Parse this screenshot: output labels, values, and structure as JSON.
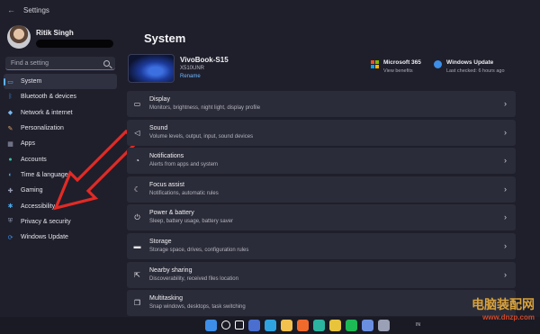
{
  "window": {
    "title": "Settings"
  },
  "profile": {
    "name": "Ritik Singh"
  },
  "search": {
    "placeholder": "Find a setting"
  },
  "nav": [
    {
      "label": "System",
      "icon": "monitor-icon",
      "active": true,
      "color": "#5fb2ff"
    },
    {
      "label": "Bluetooth & devices",
      "icon": "bluetooth-icon",
      "color": "#3a8fe3"
    },
    {
      "label": "Network & internet",
      "icon": "wifi-icon",
      "color": "#7ab8f0"
    },
    {
      "label": "Personalization",
      "icon": "brush-icon",
      "color": "#e0a060"
    },
    {
      "label": "Apps",
      "icon": "apps-icon",
      "color": "#9aa0b5"
    },
    {
      "label": "Accounts",
      "icon": "person-icon",
      "color": "#3ac0a0"
    },
    {
      "label": "Time & language",
      "icon": "globe-clock-icon",
      "color": "#4aa6e8"
    },
    {
      "label": "Gaming",
      "icon": "gamepad-icon",
      "color": "#9aa0b5"
    },
    {
      "label": "Accessibility",
      "icon": "accessibility-icon",
      "color": "#4aa6e8"
    },
    {
      "label": "Privacy & security",
      "icon": "shield-icon",
      "color": "#8e98b0"
    },
    {
      "label": "Windows Update",
      "icon": "update-icon",
      "color": "#3d8ee8"
    }
  ],
  "main": {
    "title": "System",
    "device": {
      "name": "VivoBook-S15",
      "model": "X510UNR",
      "rename": "Rename"
    },
    "quick": [
      {
        "title": "Microsoft 365",
        "sub": "View benefits",
        "icon": "microsoft-365-icon"
      },
      {
        "title": "Windows Update",
        "sub": "Last checked: 6 hours ago",
        "icon": "windows-update-icon"
      }
    ],
    "cards": [
      {
        "title": "Display",
        "sub": "Monitors, brightness, night light, display profile",
        "icon": "display-icon"
      },
      {
        "title": "Sound",
        "sub": "Volume levels, output, input, sound devices",
        "icon": "speaker-icon"
      },
      {
        "title": "Notifications",
        "sub": "Alerts from apps and system",
        "icon": "bell-icon"
      },
      {
        "title": "Focus assist",
        "sub": "Notifications, automatic rules",
        "icon": "moon-icon"
      },
      {
        "title": "Power & battery",
        "sub": "Sleep, battery usage, battery saver",
        "icon": "power-icon"
      },
      {
        "title": "Storage",
        "sub": "Storage space, drives, configuration rules",
        "icon": "storage-icon"
      },
      {
        "title": "Nearby sharing",
        "sub": "Discoverability, received files location",
        "icon": "share-icon"
      },
      {
        "title": "Multitasking",
        "sub": "Snap windows, desktops, task switching",
        "icon": "multitask-icon"
      }
    ]
  },
  "taskbar": {
    "icons": [
      "windows-start-icon",
      "search-icon",
      "task-view-icon",
      "widgets-icon",
      "telegram-icon",
      "file-explorer-icon",
      "brave-icon",
      "edge-icon",
      "chrome-icon",
      "spotify-icon",
      "photos-icon",
      "settings-icon"
    ],
    "colors": [
      "#3d8ee8",
      "#ffffff",
      "#ffffff",
      "#4a6fd0",
      "#2ea3e0",
      "#f2c14e",
      "#f06a2c",
      "#2bb5a0",
      "#e8c43c",
      "#1db954",
      "#6a8fe0",
      "#9aa0b5"
    ],
    "lang": "IN"
  },
  "watermark": {
    "cn": "电脑装配网",
    "url": "www.dnzp.com"
  }
}
